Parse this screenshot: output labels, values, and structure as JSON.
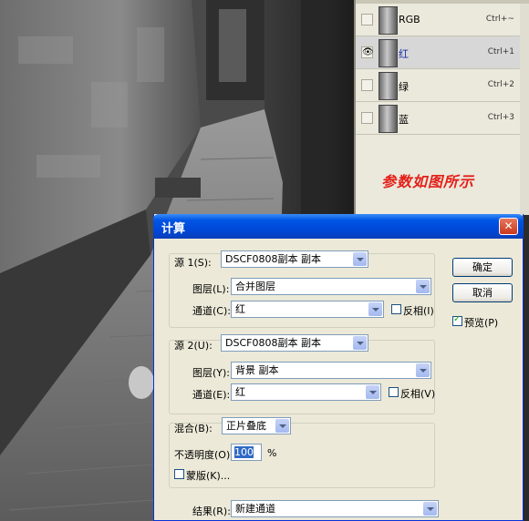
{
  "panel": {
    "channels": [
      {
        "name": "RGB",
        "shortcut": "Ctrl+~",
        "visible": false,
        "selected": false
      },
      {
        "name": "红",
        "shortcut": "Ctrl+1",
        "visible": true,
        "selected": true
      },
      {
        "name": "绿",
        "shortcut": "Ctrl+2",
        "visible": false,
        "selected": false
      },
      {
        "name": "蓝",
        "shortcut": "Ctrl+3",
        "visible": false,
        "selected": false
      }
    ],
    "note": "参数如图所示",
    "note_color": "#e32019"
  },
  "dialog": {
    "title": "计算",
    "close_glyph": "✕",
    "source1": {
      "label": "源 1(S):",
      "value": "DSCF0808副本 副本",
      "layer_label": "图层(L):",
      "layer_value": "合并图层",
      "channel_label": "通道(C):",
      "channel_value": "红",
      "invert_label": "反相(I)",
      "invert_checked": false
    },
    "source2": {
      "label": "源 2(U):",
      "value": "DSCF0808副本 副本",
      "layer_label": "图层(Y):",
      "layer_value": "背景 副本",
      "channel_label": "通道(E):",
      "channel_value": "红",
      "invert_label": "反相(V)",
      "invert_checked": false
    },
    "blend": {
      "label": "混合(B):",
      "value": "正片叠底",
      "opacity_label": "不透明度(O):",
      "opacity_value": "100",
      "opacity_unit": "%",
      "mask_label": "蒙版(K)...",
      "mask_checked": false
    },
    "result": {
      "label": "结果(R):",
      "value": "新建通道"
    },
    "buttons": {
      "ok": "确定",
      "cancel": "取消",
      "preview": "预览(P)",
      "preview_checked": true
    }
  },
  "colors": {
    "title_bar": "#0055e5",
    "dialog_bg": "#ece9d8",
    "panel_bg": "#ebe9dc"
  }
}
